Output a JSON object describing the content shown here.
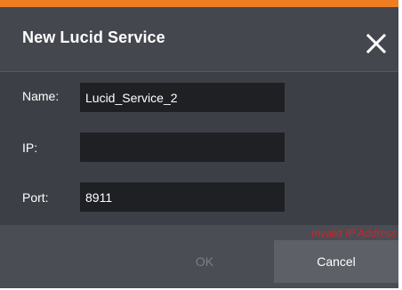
{
  "dialog": {
    "title": "New Lucid Service",
    "accent_color": "#ef7d22",
    "close_icon": "close-icon"
  },
  "form": {
    "name_label": "Name:",
    "name_value": "Lucid_Service_2",
    "ip_label": "IP:",
    "ip_value": "",
    "port_label": "Port:",
    "port_value": "8911"
  },
  "footer": {
    "error_message": "Invalid IP Address",
    "error_color": "#d8202a",
    "ok_label": "OK",
    "ok_disabled": true,
    "cancel_label": "Cancel"
  }
}
